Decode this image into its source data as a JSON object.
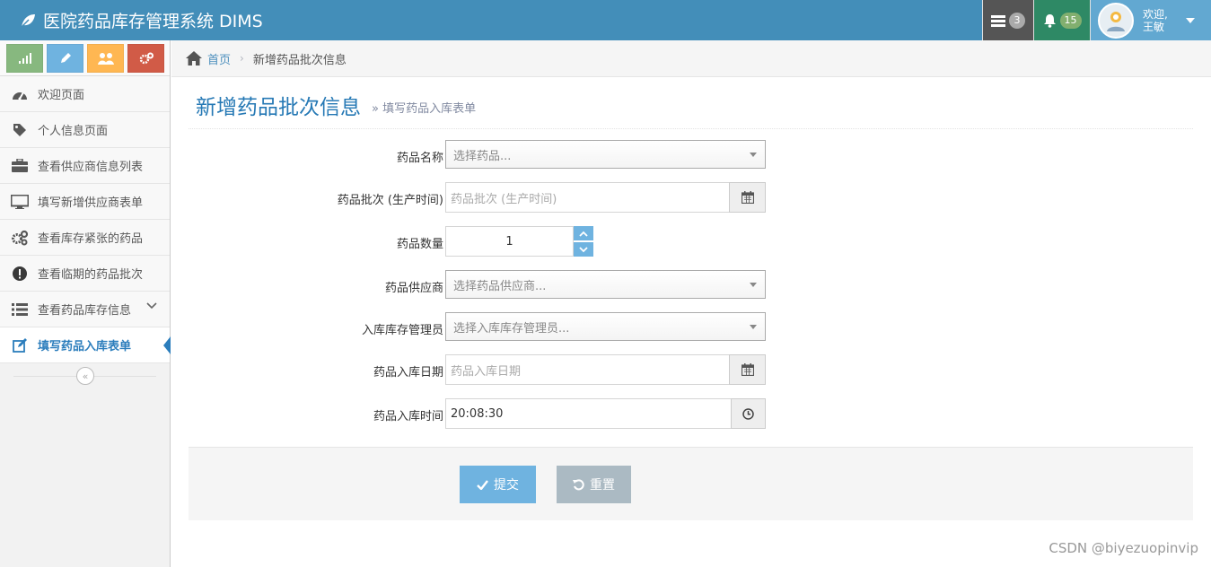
{
  "navbar": {
    "brand": "医院药品库存管理系统 DIMS",
    "tasks_count": "3",
    "notifications_count": "15",
    "user_greeting": "欢迎,",
    "user_name": "王敏"
  },
  "sidebar": {
    "shortcuts": [
      "signal-icon",
      "pencil-icon",
      "users-icon",
      "cogs-icon"
    ],
    "items": [
      {
        "label": "欢迎页面",
        "icon": "dashboard-icon"
      },
      {
        "label": "个人信息页面",
        "icon": "tag-icon"
      },
      {
        "label": "查看供应商信息列表",
        "icon": "briefcase-icon"
      },
      {
        "label": "填写新增供应商表单",
        "icon": "desktop-icon"
      },
      {
        "label": "查看库存紧张的药品",
        "icon": "cogs-icon"
      },
      {
        "label": "查看临期的药品批次",
        "icon": "exclamation-circle-icon"
      },
      {
        "label": "查看药品库存信息",
        "icon": "list-icon"
      },
      {
        "label": "填写药品入库表单",
        "icon": "pencil-square-icon"
      }
    ],
    "collapse_glyph": "«"
  },
  "breadcrumb": {
    "home": "首页",
    "current": "新增药品批次信息"
  },
  "page": {
    "title": "新增药品批次信息",
    "subtitle": "» 填写药品入库表单"
  },
  "form": {
    "drug_name": {
      "label": "药品名称",
      "placeholder": "选择药品..."
    },
    "batch": {
      "label": "药品批次 (生产时间)",
      "placeholder": "药品批次 (生产时间)"
    },
    "quantity": {
      "label": "药品数量",
      "value": "1"
    },
    "supplier": {
      "label": "药品供应商",
      "placeholder": "选择药品供应商..."
    },
    "manager": {
      "label": "入库库存管理员",
      "placeholder": "选择入库库存管理员..."
    },
    "in_date": {
      "label": "药品入库日期",
      "placeholder": "药品入库日期"
    },
    "in_time": {
      "label": "药品入库时间",
      "value": "20:08:30"
    }
  },
  "actions": {
    "submit": "提交",
    "reset": "重置"
  },
  "colors": {
    "navbar": "#438eb9",
    "accent": "#2b7dbc",
    "submit": "#6fb3e0",
    "reset": "#abbac3"
  },
  "watermark": "CSDN @biyezuopinvip"
}
